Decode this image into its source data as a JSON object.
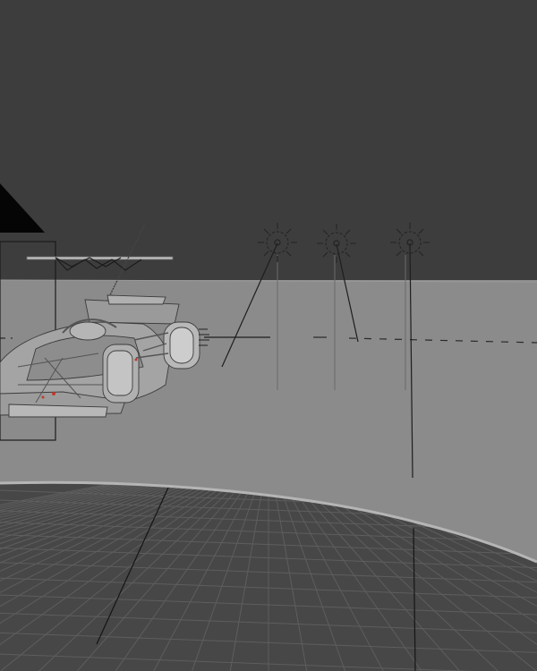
{
  "app": {
    "view": "3d-viewport",
    "shading_mode": "solid"
  },
  "scene": {
    "objects": [
      {
        "name": "race-car-model",
        "kind": "mesh"
      },
      {
        "name": "camera-frustum",
        "kind": "camera"
      },
      {
        "name": "light-1",
        "kind": "point-light"
      },
      {
        "name": "light-2",
        "kind": "point-light"
      },
      {
        "name": "light-3",
        "kind": "point-light"
      },
      {
        "name": "backdrop-plane",
        "kind": "mesh"
      },
      {
        "name": "floor-grid",
        "kind": "grid"
      }
    ]
  },
  "colors": {
    "background": "#3d3d3d",
    "backdrop": "#8b8b8b",
    "floor": "#474747",
    "grid_line": "#5e5e5e",
    "floor_rim": "#b5b5b5",
    "car_body": "#9a9a9a",
    "light_gizmo": "#222222"
  }
}
